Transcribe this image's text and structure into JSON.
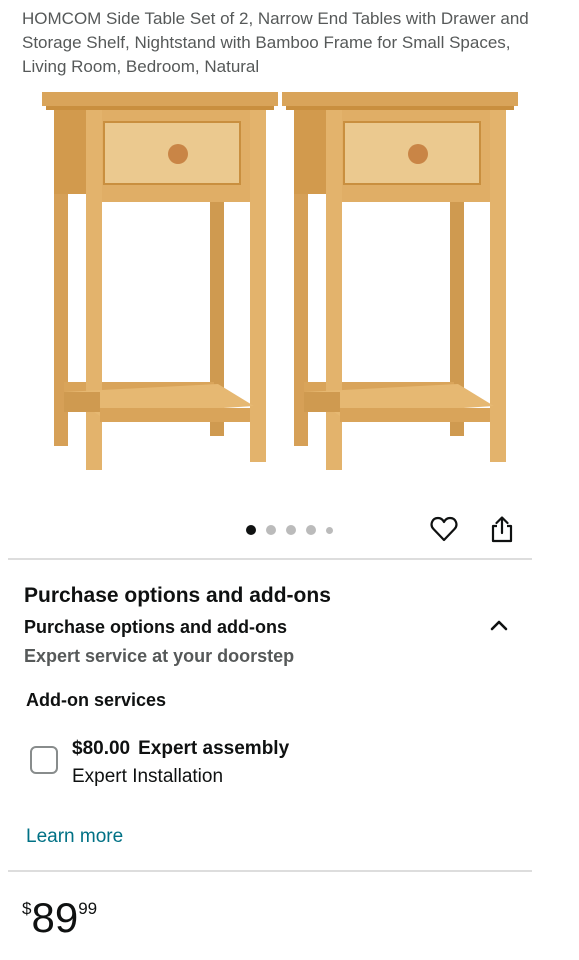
{
  "product": {
    "title": "HOMCOM Side Table Set of 2, Narrow End Tables with Drawer and Storage Shelf, Nightstand with Bamboo Frame for Small Spaces, Living Room, Bedroom, Natural",
    "image_colors": {
      "wood": "#e3b36c",
      "wood_dark": "#c98f3f",
      "drawer": "#ebc98f"
    }
  },
  "gallery": {
    "dots_count": 5,
    "active_dot": 1
  },
  "icons": {
    "favorite": "heart-icon",
    "share": "share-icon",
    "collapse": "chevron-up-icon"
  },
  "purchase_options": {
    "title": "Purchase options and add-ons",
    "subtitle": "Purchase options and add-ons",
    "tagline": "Expert service at your doorstep"
  },
  "addons": {
    "heading": "Add-on services",
    "service": {
      "price": "$80.00",
      "name": "Expert assembly",
      "description": "Expert Installation",
      "checked": false
    },
    "learn_more": "Learn more"
  },
  "price": {
    "symbol": "$",
    "whole": "89",
    "fraction": "99"
  },
  "colors": {
    "link": "#007185",
    "text": "#0f1111",
    "muted": "#565959",
    "divider": "#dddddd"
  }
}
